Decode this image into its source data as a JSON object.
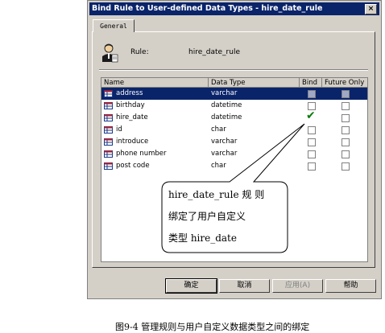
{
  "window": {
    "title": "Bind Rule to User-defined Data Types - hire_date_rule",
    "close_glyph": "×"
  },
  "tabs": [
    {
      "label": "General"
    }
  ],
  "rule": {
    "label": "Rule:",
    "value": "hire_date_rule"
  },
  "table": {
    "columns": [
      "Name",
      "Data Type",
      "Bind",
      "Future Only"
    ],
    "rows": [
      {
        "name": "address",
        "type": "varchar",
        "bind": false,
        "future": false,
        "selected": true
      },
      {
        "name": "birthday",
        "type": "datetime",
        "bind": false,
        "future": false,
        "selected": false
      },
      {
        "name": "hire_date",
        "type": "datetime",
        "bind": true,
        "future": false,
        "selected": false
      },
      {
        "name": "id",
        "type": "char",
        "bind": false,
        "future": false,
        "selected": false
      },
      {
        "name": "introduce",
        "type": "varchar",
        "bind": false,
        "future": false,
        "selected": false
      },
      {
        "name": "phone number",
        "type": "varchar",
        "bind": false,
        "future": false,
        "selected": false
      },
      {
        "name": "post code",
        "type": "char",
        "bind": false,
        "future": false,
        "selected": false
      }
    ]
  },
  "callout": {
    "line1": "hire_date_rule  规 则",
    "line2": "绑定了用户自定义",
    "line3": "类型 hire_date"
  },
  "buttons": {
    "ok": "确定",
    "cancel": "取消",
    "apply": "应用(A)",
    "help": "帮助"
  },
  "caption": "图9-4  管理规则与用户自定义数据类型之间的绑定",
  "colors": {
    "titlebar": "#0a246a",
    "dialog_bg": "#d4d0c8",
    "selection": "#0a246a",
    "check": "#0a7a0a"
  }
}
